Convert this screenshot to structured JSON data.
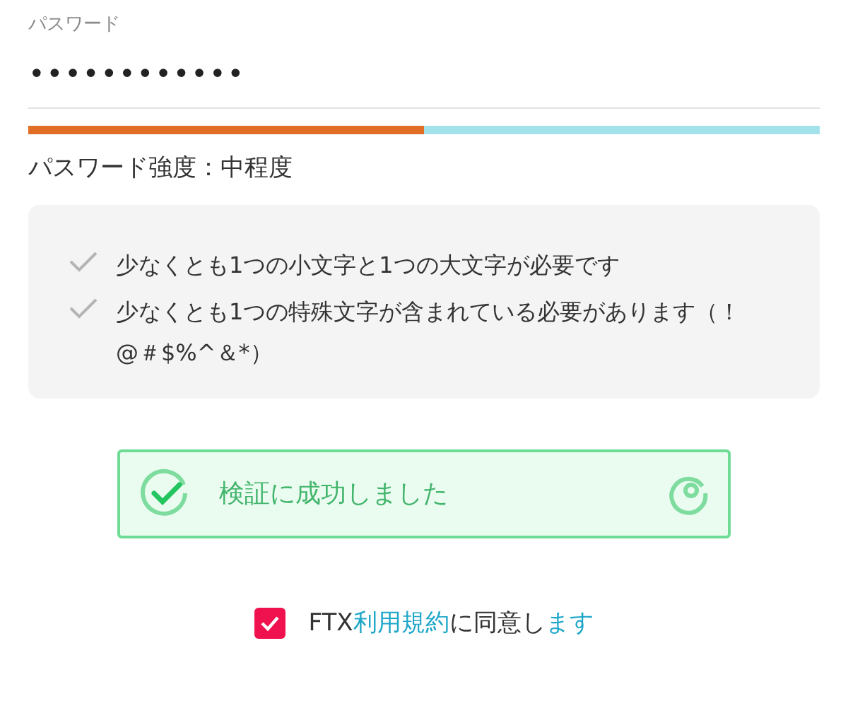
{
  "password_field": {
    "label": "パスワード",
    "value": "••••••••••••"
  },
  "strength": {
    "level": 0.5,
    "text": "パスワード強度：中程度"
  },
  "requirements": [
    {
      "text": "少なくとも1つの小文字と1つの大文字が必要です"
    },
    {
      "text": "少なくとも1つの特殊文字が含まれている必要があります（！@＃$%^＆*）"
    }
  ],
  "verification": {
    "text": "検証に成功しました",
    "verified": true
  },
  "agreement": {
    "checked": true,
    "parts": [
      {
        "text": "FTX",
        "link": false
      },
      {
        "text": "利用規約",
        "link": true
      },
      {
        "text": "に同意し",
        "link": false
      },
      {
        "text": "ます",
        "link": true
      }
    ]
  }
}
